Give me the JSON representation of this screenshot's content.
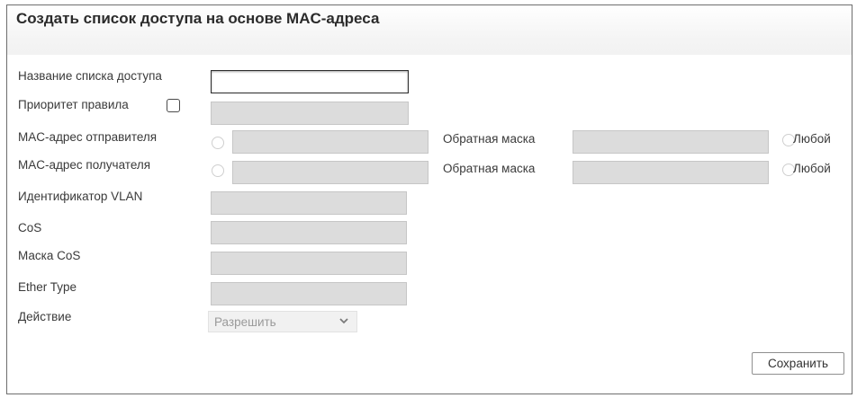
{
  "title": "Создать список доступа на основе MAC-адреса",
  "fields": {
    "acl_name": {
      "label": "Название списка доступа",
      "value": ""
    },
    "priority": {
      "label": "Приоритет правила",
      "checked": false,
      "value": ""
    },
    "src_mac": {
      "label": "MAC-адрес отправителя",
      "value": "",
      "mask_label": "Обратная маска",
      "mask_value": "",
      "any_label": "Любой"
    },
    "dst_mac": {
      "label": "MAC-адрес получателя",
      "value": "",
      "mask_label": "Обратная маска",
      "mask_value": "",
      "any_label": "Любой"
    },
    "vlan_id": {
      "label": "Идентификатор VLAN",
      "value": ""
    },
    "cos": {
      "label": "CoS",
      "value": ""
    },
    "cos_mask": {
      "label": "Маска CoS",
      "value": ""
    },
    "ether_type": {
      "label": "Ether Type",
      "value": ""
    },
    "action": {
      "label": "Действие",
      "selected": "Разрешить"
    }
  },
  "save_label": "Сохранить"
}
